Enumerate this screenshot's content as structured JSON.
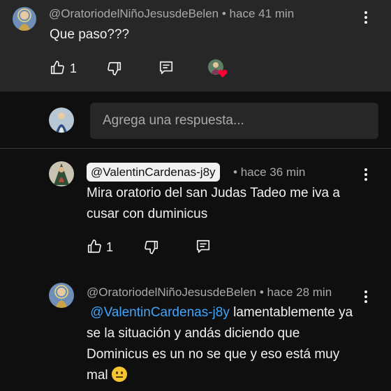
{
  "comment_1": {
    "author": "@OratoriodelNiñoJesusdeBelen",
    "separator": "•",
    "time": "hace 41 min",
    "text": "Que paso???",
    "like_count": "1"
  },
  "reply_input": {
    "placeholder": "Agrega una respuesta..."
  },
  "reply_1": {
    "author": "@ValentinCardenas-j8y",
    "separator": "•",
    "time": "hace 36 min",
    "text": "Mira oratorio del san Judas Tadeo me iva a cusar con duminicus",
    "like_count": "1"
  },
  "reply_2": {
    "author": "@OratoriodelNiñoJesusdeBelen",
    "separator": "•",
    "time": "hace 28 min",
    "mention": "@ValentinCardenas-j8y",
    "text": "lamentablemente ya se la situación y andás diciendo que Dominicus es un no se que y eso está muy mal"
  },
  "icons": [
    "thumb-up-icon",
    "thumb-down-icon",
    "reply-comment-icon",
    "kebab-menu-icon",
    "creator-heart-icon",
    "neutral-face-emoji"
  ],
  "colors": {
    "background": "#0f0f0f",
    "highlight_background": "#272727",
    "mention": "#3ea6ff",
    "heart": "#ff0033"
  }
}
